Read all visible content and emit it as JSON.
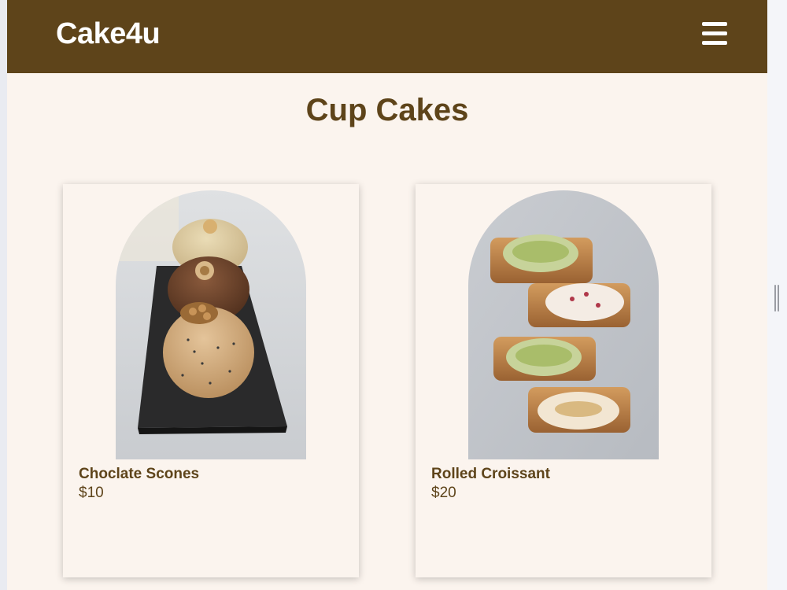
{
  "header": {
    "brand": "Cake4u",
    "menu_icon": "hamburger-menu-icon"
  },
  "section": {
    "title": "Cup Cakes"
  },
  "products": [
    {
      "name": "Choclate Scones",
      "price": "$10",
      "image": "chocolate-scones-photo"
    },
    {
      "name": "Rolled Croissant",
      "price": "$20",
      "image": "rolled-croissant-photo"
    }
  ],
  "colors": {
    "brand_brown": "#5e441a",
    "page_background": "#fbf4ee",
    "outer_background": "#f4f5f9"
  }
}
